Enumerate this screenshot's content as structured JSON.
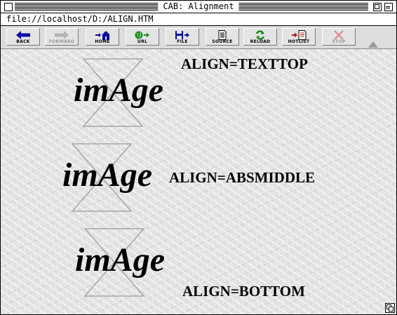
{
  "window": {
    "title": "CAB: Alignment"
  },
  "url": {
    "value": "file://localhost/D:/ALIGN.HTM"
  },
  "toolbar": {
    "items": [
      {
        "label": "BACK",
        "icon": "back-arrow-icon",
        "enabled": true
      },
      {
        "label": "FORWARD",
        "icon": "forward-arrow-icon",
        "enabled": false
      },
      {
        "label": "HOME",
        "icon": "home-icon",
        "enabled": true
      },
      {
        "label": "URL",
        "icon": "url-globe-icon",
        "enabled": true
      },
      {
        "label": "FILE",
        "icon": "file-disk-icon",
        "enabled": true
      },
      {
        "label": "SOURCE",
        "icon": "source-document-icon",
        "enabled": true
      },
      {
        "label": "RELOAD",
        "icon": "reload-icon",
        "enabled": true
      },
      {
        "label": "HOTLIST",
        "icon": "hotlist-icon",
        "enabled": true
      },
      {
        "label": "STOP",
        "icon": "stop-icon",
        "enabled": false
      }
    ]
  },
  "content": {
    "image_word": "imAge",
    "examples": [
      {
        "label": "ALIGN=TEXTTOP"
      },
      {
        "label": "ALIGN=ABSMIDDLE"
      },
      {
        "label": "ALIGN=BOTTOM"
      }
    ]
  },
  "colors": {
    "icon_blue": "#0a0aa0",
    "icon_green": "#1a8a1a",
    "icon_red": "#c01010",
    "disabled": "#999999",
    "content_bg": "#e2e2e2"
  }
}
